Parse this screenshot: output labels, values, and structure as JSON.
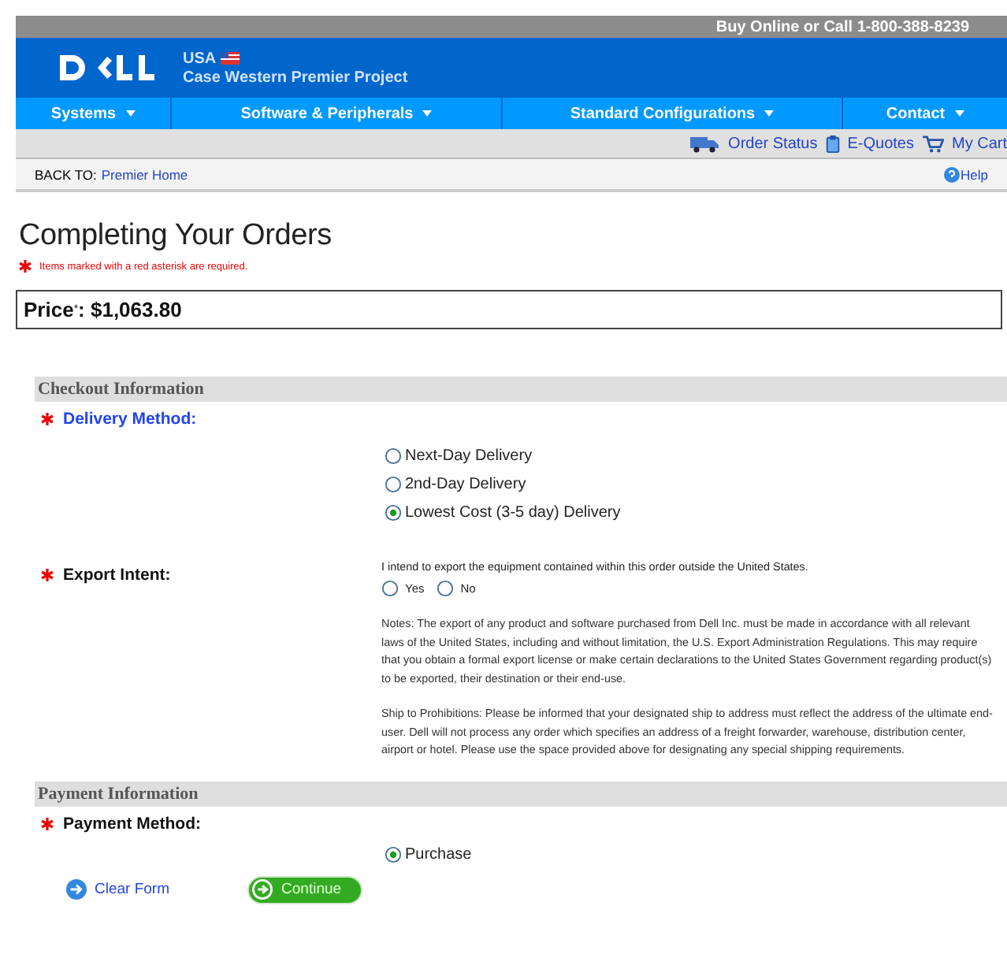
{
  "top_bar": {
    "text": "Buy Online or Call 1-800-388-8239"
  },
  "header": {
    "country": "USA",
    "project": "Case Western Premier Project"
  },
  "nav": [
    {
      "label": "Systems"
    },
    {
      "label": "Software & Peripherals"
    },
    {
      "label": "Standard Configurations"
    },
    {
      "label": "Contact"
    }
  ],
  "toolbar": [
    {
      "kind": "truck",
      "label": "Order Status"
    },
    {
      "kind": "clipboard",
      "label": "E-Quotes"
    },
    {
      "kind": "cart",
      "label": "My Cart"
    }
  ],
  "back_bar": {
    "label": "BACK TO:",
    "link": "Premier Home",
    "help": "Help"
  },
  "title": "Completing Your Orders",
  "required_note": "Items marked with a red asterisk are required.",
  "price": "Price$^{*}$: $1,063.80",
  "checkout": {
    "header": "Checkout Information",
    "delivery": {
      "label": "Delivery Method:",
      "required": true,
      "highlighted": true,
      "options": [
        {
          "label": "Next-Day Delivery",
          "selected": false
        },
        {
          "label": "2nd-Day Delivery",
          "selected": false
        },
        {
          "label": "Lowest Cost (3-5 day) Delivery",
          "selected": true
        }
      ]
    },
    "export": {
      "label": "Export Intent:",
      "required": true,
      "highlighted": false,
      "question": "I intend to export the equipment contained within this order outside the United States.",
      "options": [
        {
          "label": "Yes",
          "selected": false
        },
        {
          "label": "No",
          "selected": false
        }
      ],
      "notes": [
        "Notes: The export of any product and software purchased from Dell Inc. must be made in accordance with all relevant laws of the United States, including and without limitation, the U.S. Export Administration Regulations. This may require that you obtain a formal export license or make certain declarations to the United States Government regarding product(s) to be exported, their destination or their end-use.",
        "Ship to Prohibitions: Please be informed that your designated ship to address must reflect the address of the ultimate end-user. Dell will not process any order which specifies an address of a freight forwarder, warehouse, distribution center, airport or hotel. Please use the space provided above for designating any special shipping requirements."
      ]
    }
  },
  "payment": {
    "header": "Payment Information",
    "method": {
      "label": "Payment Method:",
      "required": true,
      "highlighted": false,
      "options": [
        {
          "label": "Purchase",
          "selected": true
        }
      ]
    }
  },
  "actions": {
    "clear": "Clear Form",
    "continue": "Continue"
  }
}
